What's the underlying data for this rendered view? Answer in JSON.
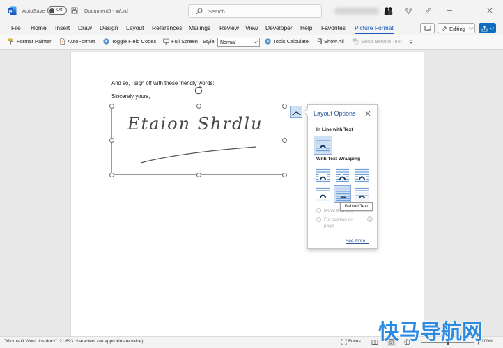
{
  "app": {
    "autosave_label": "AutoSave",
    "autosave_state": "Off",
    "title": "Document5 - Word",
    "search_placeholder": "Search"
  },
  "menu": {
    "tabs": [
      "File",
      "Home",
      "Insert",
      "Draw",
      "Design",
      "Layout",
      "References",
      "Mailings",
      "Review",
      "View",
      "Developer",
      "Help",
      "Favorites",
      "Picture Format"
    ],
    "editing_label": "Editing"
  },
  "toolbar": {
    "items": [
      {
        "label": "Format Painter",
        "icon": "format-painter-icon"
      },
      {
        "label": "AutoFormat",
        "icon": "autoformat-icon"
      },
      {
        "label": "Toggle Field Codes",
        "icon": "field-codes-icon"
      },
      {
        "label": "Full Screen",
        "icon": "full-screen-icon"
      },
      {
        "label": "Tools Calculate",
        "icon": "calculate-icon"
      },
      {
        "label": "Show All",
        "icon": "pilcrow-icon"
      },
      {
        "label": "Send Behind Text",
        "icon": "send-behind-icon",
        "enabled": false
      }
    ],
    "style_label": "Style:",
    "style_value": "Normal"
  },
  "document": {
    "lines": [
      "And so, I sign off with these friendly words:",
      "Sincerely yours,"
    ],
    "signature": "Etaion Shrdlu"
  },
  "layout_options": {
    "title": "Layout Options",
    "inline_heading": "In Line with Text",
    "wrapping_heading": "With Text Wrapping",
    "wrap_icons": [
      "square-wrap-icon",
      "tight-wrap-icon",
      "through-wrap-icon",
      "top-bottom-wrap-icon",
      "behind-text-icon",
      "in-front-of-text-icon"
    ],
    "tooltip": "Behind Text",
    "move_with_text": "Move with text",
    "fix_position": "Fix position on page",
    "see_more": "See more..."
  },
  "status": {
    "doc_info": "\"Microsoft Word tips.docx\": 21,693 characters (an approximate value).",
    "focus_label": "Focus",
    "zoom": "100%"
  },
  "watermark": "快马导航网",
  "colors": {
    "accent": "#185abd",
    "link": "#2b579a",
    "share": "#0f6cbd",
    "watermark": "#2c8be0"
  }
}
